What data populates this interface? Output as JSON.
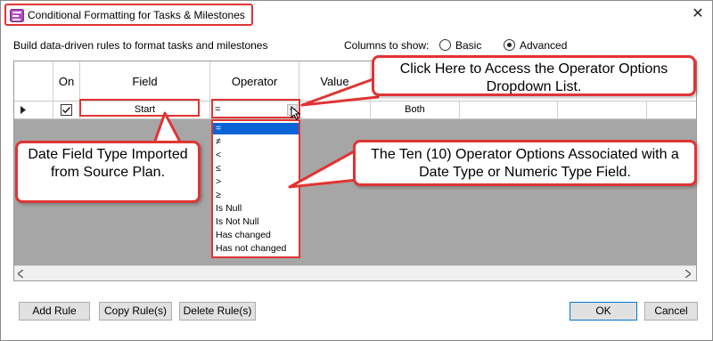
{
  "window": {
    "title": "Conditional Formatting for Tasks & Milestones",
    "close_glyph": "✕"
  },
  "toolbar": {
    "description": "Build data-driven rules to format tasks and milestones",
    "columns_label": "Columns to show:",
    "basic_label": "Basic",
    "advanced_label": "Advanced",
    "selected": "Advanced"
  },
  "grid": {
    "columns": [
      "On",
      "Field",
      "Operator",
      "Value"
    ],
    "row": {
      "on_checked": true,
      "field": "Start",
      "operator": "=",
      "extra": "Both"
    }
  },
  "operator_options": [
    "=",
    "≠",
    "<",
    "≤",
    ">",
    "≥",
    "Is Null",
    "Is Not Null",
    "Has changed",
    "Has not changed"
  ],
  "callouts": {
    "operator_hint": "Click Here to Access the Operator Options Dropdown List.",
    "field_type": "Date Field Type Imported from Source Plan.",
    "ten_options": "The Ten (10) Operator Options Associated with a Date Type or Numeric Type Field."
  },
  "buttons": {
    "add_rule": "Add Rule",
    "copy_rule": "Copy Rule(s)",
    "delete_rule": "Delete Rule(s)",
    "ok": "OK",
    "cancel": "Cancel"
  },
  "colors": {
    "annotation_red": "#e03434",
    "selection_blue": "#0a64d6",
    "grid_gray": "#a6a6a6"
  }
}
